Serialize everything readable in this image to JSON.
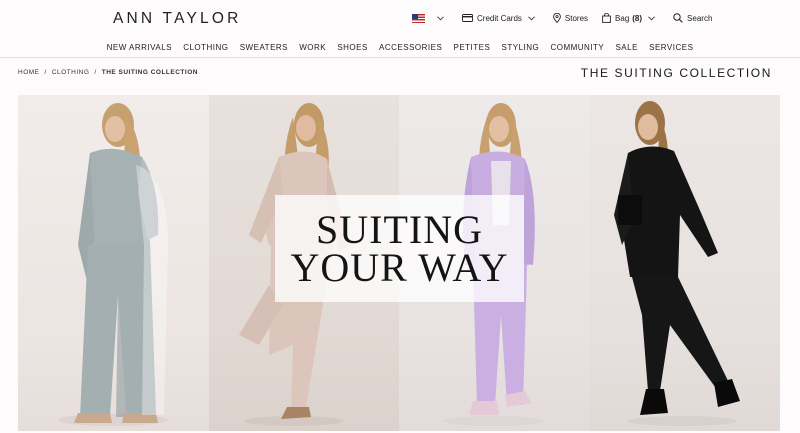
{
  "header": {
    "logo": "ANN TAYLOR",
    "utilities": {
      "country_flag": "us-flag-icon",
      "credit_cards": "Credit Cards",
      "stores": "Stores",
      "bag_label": "Bag",
      "bag_count": "(8)",
      "search": "Search"
    }
  },
  "nav": {
    "items": [
      "NEW ARRIVALS",
      "CLOTHING",
      "SWEATERS",
      "WORK",
      "SHOES",
      "ACCESSORIES",
      "PETITES",
      "STYLING",
      "COMMUNITY",
      "SALE",
      "SERVICES"
    ]
  },
  "breadcrumb": {
    "home": "HOME",
    "clothing": "CLOTHING",
    "current": "THE SUITING COLLECTION",
    "separator": "/"
  },
  "page_title": "THE SUITING COLLECTION",
  "hero": {
    "headline_line1": "SUITING",
    "headline_line2": "YOUR WAY",
    "suit_colors": [
      "#a9b3b4",
      "#d9c3b8",
      "#c7aede",
      "#111111"
    ]
  }
}
